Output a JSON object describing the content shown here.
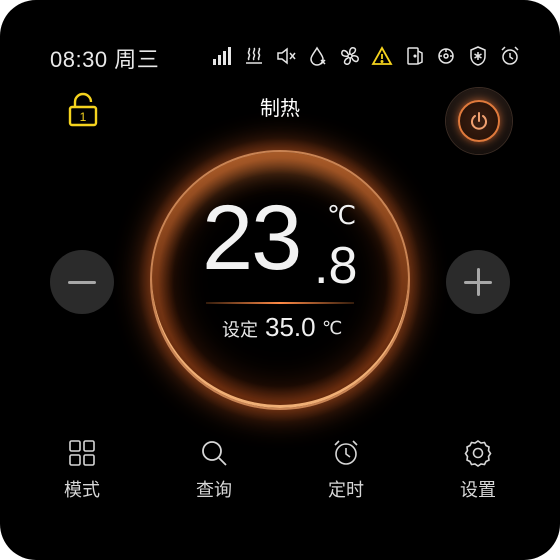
{
  "status_bar": {
    "time": "08:30",
    "weekday": "周三",
    "icons": [
      "signal-icon",
      "heat-wave-icon",
      "mute-icon",
      "water-drop-snowflake-icon",
      "fan-icon",
      "warning-icon",
      "door-icon",
      "fan-coil-icon",
      "shield-snowflake-icon",
      "alarm-clock-icon"
    ]
  },
  "lock": {
    "label": "1",
    "color": "#f5d31e"
  },
  "mode_title": "制热",
  "temperature": {
    "current_integer": "23",
    "current_decimal": ".8",
    "unit": "℃",
    "set_label": "设定",
    "set_value": "35.0",
    "set_unit": "℃"
  },
  "colors": {
    "accent": "#ff8a46",
    "warning": "#f5d31e",
    "background": "#000000"
  },
  "nav": [
    {
      "label": "模式",
      "icon": "grid-icon"
    },
    {
      "label": "查询",
      "icon": "search-icon"
    },
    {
      "label": "定时",
      "icon": "alarm-clock-icon"
    },
    {
      "label": "设置",
      "icon": "gear-icon"
    }
  ]
}
